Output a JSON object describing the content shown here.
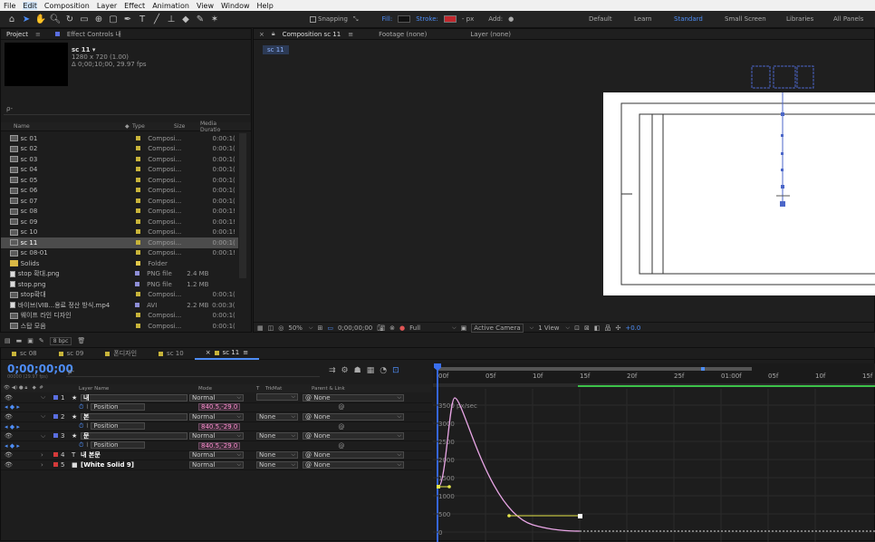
{
  "menu": [
    "File",
    "Edit",
    "Composition",
    "Layer",
    "Effect",
    "Animation",
    "View",
    "Window",
    "Help"
  ],
  "toolbar": {
    "snapping": "Snapping",
    "fill": "Fill:",
    "stroke": "Stroke:",
    "stroke_px": "- px",
    "add": "Add:",
    "workspaces": [
      "Default",
      "Learn",
      "Standard",
      "Small Screen",
      "Libraries",
      "All Panels"
    ],
    "active_workspace": "Standard"
  },
  "project": {
    "tab_project": "Project",
    "tab_effect": "Effect Controls 내",
    "comp_name": "sc 11 ▾",
    "comp_info1": "1280 x 720 (1.00)",
    "comp_info2": "Δ 0;00;10;00, 29.97 fps",
    "search_placeholder": "ρ-",
    "columns": {
      "name": "Name",
      "type": "Type",
      "size": "Size",
      "dur": "Media Duratio"
    },
    "items": [
      {
        "name": "sc 01",
        "type": "Composi...",
        "size": "",
        "dur": "0:00:1(",
        "color": "#c8b43a",
        "kind": "comp"
      },
      {
        "name": "sc 02",
        "type": "Composi...",
        "size": "",
        "dur": "0:00:1(",
        "color": "#c8b43a",
        "kind": "comp"
      },
      {
        "name": "sc 03",
        "type": "Composi...",
        "size": "",
        "dur": "0:00:1(",
        "color": "#c8b43a",
        "kind": "comp"
      },
      {
        "name": "sc 04",
        "type": "Composi...",
        "size": "",
        "dur": "0:00:1(",
        "color": "#c8b43a",
        "kind": "comp"
      },
      {
        "name": "sc 05",
        "type": "Composi...",
        "size": "",
        "dur": "0:00:1(",
        "color": "#c8b43a",
        "kind": "comp"
      },
      {
        "name": "sc 06",
        "type": "Composi...",
        "size": "",
        "dur": "0:00:1(",
        "color": "#c8b43a",
        "kind": "comp"
      },
      {
        "name": "sc 07",
        "type": "Composi...",
        "size": "",
        "dur": "0:00:1(",
        "color": "#c8b43a",
        "kind": "comp"
      },
      {
        "name": "sc 08",
        "type": "Composi...",
        "size": "",
        "dur": "0:00:1!",
        "color": "#c8b43a",
        "kind": "comp"
      },
      {
        "name": "sc 09",
        "type": "Composi...",
        "size": "",
        "dur": "0:00:1!",
        "color": "#c8b43a",
        "kind": "comp"
      },
      {
        "name": "sc 10",
        "type": "Composi...",
        "size": "",
        "dur": "0:00:1!",
        "color": "#c8b43a",
        "kind": "comp"
      },
      {
        "name": "sc 11",
        "type": "Composi...",
        "size": "",
        "dur": "0:00:1(",
        "color": "#c8b43a",
        "kind": "comp",
        "selected": true
      },
      {
        "name": "sc 08-01",
        "type": "Composi...",
        "size": "",
        "dur": "0:00:1!",
        "color": "#c8b43a",
        "kind": "comp"
      },
      {
        "name": "Solids",
        "type": "Folder",
        "size": "",
        "dur": "",
        "color": "#e2c94a",
        "kind": "folder"
      },
      {
        "name": "stop 확대.png",
        "type": "PNG file",
        "size": "2.4 MB",
        "dur": "",
        "color": "#8e8ed6",
        "kind": "file"
      },
      {
        "name": "stop.png",
        "type": "PNG file",
        "size": "1.2 MB",
        "dur": "",
        "color": "#8e8ed6",
        "kind": "file"
      },
      {
        "name": "stop확대",
        "type": "Composi...",
        "size": "",
        "dur": "0:00:1(",
        "color": "#c8b43a",
        "kind": "comp"
      },
      {
        "name": "바이브(VIB...용료 정산 방식.mp4",
        "type": "AVI",
        "size": "2.2 MB",
        "dur": "0:00:3(",
        "color": "#8e8ed6",
        "kind": "video"
      },
      {
        "name": "웨이프 라인 디자인",
        "type": "Composi...",
        "size": "",
        "dur": "0:00:1(",
        "color": "#c8b43a",
        "kind": "comp"
      },
      {
        "name": "스탑 모음",
        "type": "Composi...",
        "size": "",
        "dur": "0:00:1(",
        "color": "#c8b43a",
        "kind": "comp"
      }
    ],
    "bpc": "8 bpc"
  },
  "viewer": {
    "tab_comp": "Composition sc 11",
    "tab_footage": "Footage (none)",
    "tab_layer": "Layer (none)",
    "comp_chip": "sc 11",
    "zoom": "50%",
    "timecode": "0;00;00;00",
    "resolution": "Full",
    "camera": "Active Camera",
    "view": "1 View",
    "exposure": "+0.0"
  },
  "timeline": {
    "tabs": [
      "sc 08",
      "sc 09",
      "폰디자인",
      "sc 10",
      "sc 11"
    ],
    "active_tab": "sc 11",
    "timecode": "0;00;00;00",
    "timecode_sub": "00000 (29.97 fps)",
    "search_placeholder": "ρ-",
    "col_layer": "Layer Name",
    "col_mode": "Mode",
    "col_t": "T",
    "col_trkmat": "TrkMat",
    "col_parent": "Parent & Link",
    "ruler": [
      "00f",
      "05f",
      "10f",
      "15f",
      "20f",
      "25f",
      "01:00f",
      "05f",
      "10f",
      "15f"
    ],
    "graph_labels": [
      "3500 px/sec",
      "3000",
      "2500",
      "2000",
      "1500",
      "1000",
      "500",
      "0"
    ],
    "layers": [
      {
        "num": "1",
        "name": "내",
        "mode": "Normal",
        "trkmat": "",
        "parent": "None",
        "color": "#5a6ee0",
        "type": "star",
        "boxed": true
      },
      {
        "prop": true,
        "name": "Position",
        "value": "840.5,-29.0"
      },
      {
        "num": "2",
        "name": "본",
        "mode": "Normal",
        "trkmat": "None",
        "parent": "None",
        "color": "#5a6ee0",
        "type": "star",
        "boxed": true
      },
      {
        "prop": true,
        "name": "Position",
        "value": "840.5,-29.0"
      },
      {
        "num": "3",
        "name": "문",
        "mode": "Normal",
        "trkmat": "None",
        "parent": "None",
        "color": "#5a6ee0",
        "type": "star",
        "boxed": true
      },
      {
        "prop": true,
        "name": "Position",
        "value": "840.5,-29.0"
      },
      {
        "num": "4",
        "name": "내 본문",
        "mode": "Normal",
        "trkmat": "None",
        "parent": "None",
        "color": "#d43a3a",
        "type": "text"
      },
      {
        "num": "5",
        "name": "[White Solid 9]",
        "mode": "Normal",
        "trkmat": "None",
        "parent": "None",
        "color": "#d43a3a",
        "type": "solid"
      }
    ]
  }
}
